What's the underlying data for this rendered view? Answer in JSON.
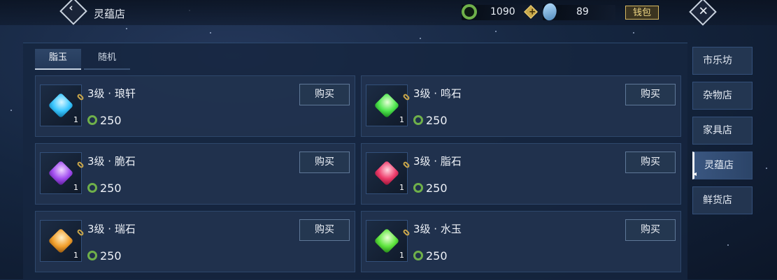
{
  "header": {
    "title": "灵蕴店",
    "currency1": "1090",
    "currency2": "89",
    "wallet_label": "钱包",
    "colors": {
      "accent_gold": "#d7b860",
      "currency_green": "#6fb04a",
      "crystal_blue": "#7fb3d6"
    }
  },
  "tabs": [
    {
      "label": "脂玉",
      "active": true
    },
    {
      "label": "随机",
      "active": false
    }
  ],
  "items": [
    {
      "name": "3级 · 琅轩",
      "price": "250",
      "qty": "1",
      "buy_label": "购买",
      "gem_color": "#39c6ff"
    },
    {
      "name": "3级 · 鸣石",
      "price": "250",
      "qty": "1",
      "buy_label": "购买",
      "gem_color": "#4ee64e"
    },
    {
      "name": "3级 · 脆石",
      "price": "250",
      "qty": "1",
      "buy_label": "购买",
      "gem_color": "#a24ef0"
    },
    {
      "name": "3级 · 脂石",
      "price": "250",
      "qty": "1",
      "buy_label": "购买",
      "gem_color": "#ef3d6c"
    },
    {
      "name": "3级 · 瑞石",
      "price": "250",
      "qty": "1",
      "buy_label": "购买",
      "gem_color": "#f2a12e"
    },
    {
      "name": "3级 · 水玉",
      "price": "250",
      "qty": "1",
      "buy_label": "购买",
      "gem_color": "#5fe63e"
    }
  ],
  "sidebar": {
    "items": [
      {
        "label": "市乐坊",
        "active": false
      },
      {
        "label": "杂物店",
        "active": false
      },
      {
        "label": "家具店",
        "active": false
      },
      {
        "label": "灵蕴店",
        "active": true
      },
      {
        "label": "鲜货店",
        "active": false
      }
    ]
  }
}
